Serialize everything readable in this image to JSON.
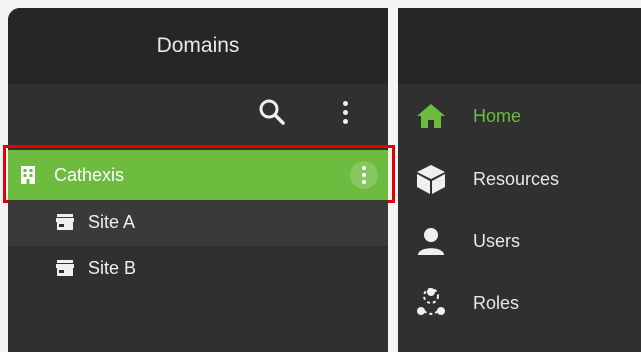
{
  "domains_panel": {
    "title": "Domains",
    "search_icon": "search-icon",
    "menu_icon": "more-vertical-icon"
  },
  "tree": {
    "selected_domain": {
      "label": "Cathexis",
      "icon": "building-icon",
      "menu_icon": "more-vertical-icon",
      "highlight_color": "#e80000",
      "selected_color": "#6dbb3f"
    },
    "sites": [
      {
        "label": "Site A",
        "icon": "store-icon"
      },
      {
        "label": "Site B",
        "icon": "store-icon"
      }
    ]
  },
  "nav": {
    "accent_color": "#6dbb3f",
    "items": [
      {
        "label": "Home",
        "icon": "home-icon",
        "active": true
      },
      {
        "label": "Resources",
        "icon": "cube-icon",
        "active": false
      },
      {
        "label": "Users",
        "icon": "user-icon",
        "active": false
      },
      {
        "label": "Roles",
        "icon": "roles-icon",
        "active": false
      }
    ]
  }
}
